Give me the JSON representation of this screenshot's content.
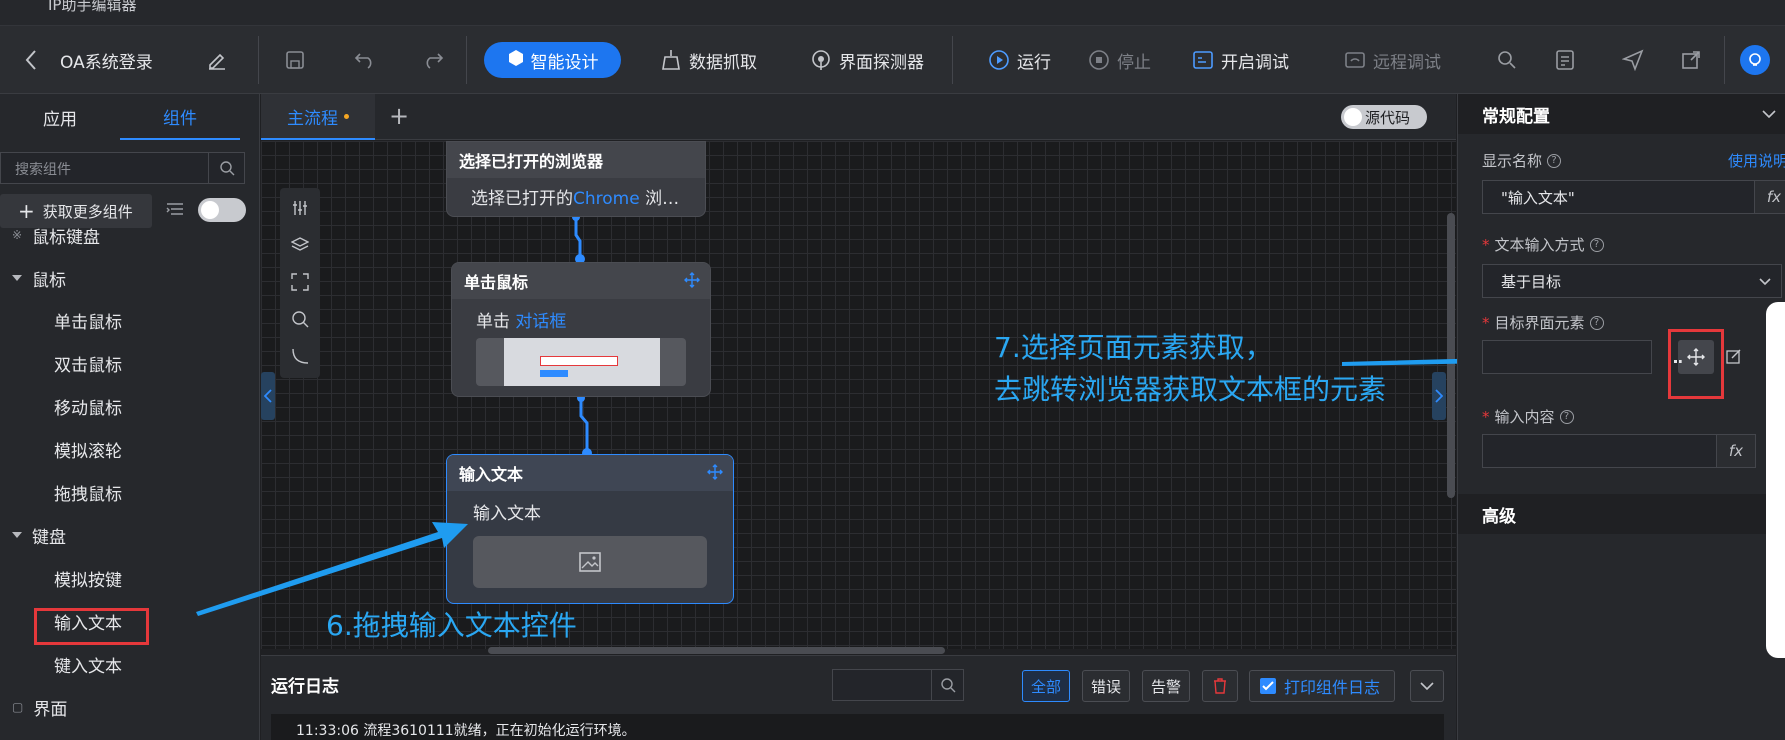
{
  "window": {
    "title": "IP助手编辑器"
  },
  "toolbar": {
    "project_name": "OA系统登录",
    "smart_design": "智能设计",
    "data_capture": "数据抓取",
    "ui_detector": "界面探测器",
    "run": "运行",
    "stop": "停止",
    "debug": "开启调试",
    "remote_debug": "远程调试"
  },
  "left": {
    "tabs": [
      "应用",
      "组件"
    ],
    "active_tab": "组件",
    "search_placeholder": "搜索组件",
    "more_components": "获取更多组件",
    "tree": {
      "partial_group": "鼠标键盘",
      "mouse_group": "鼠标",
      "mouse_items": [
        "单击鼠标",
        "双击鼠标",
        "移动鼠标",
        "模拟滚轮",
        "拖拽鼠标"
      ],
      "keyboard_group": "键盘",
      "keyboard_items": [
        "模拟按键",
        "输入文本",
        "键入文本"
      ],
      "ui_group": "界面"
    }
  },
  "canvas": {
    "tab": "主流程",
    "source_code": "源代码",
    "nodes": [
      {
        "title": "选择已打开的浏览器",
        "body_prefix": "选择已打开的",
        "body_link": "Chrome",
        "body_suffix": " 浏…"
      },
      {
        "title": "单击鼠标",
        "body_prefix": "单击 ",
        "body_link": "对话框"
      },
      {
        "title": "输入文本",
        "body_prefix": "输入文本"
      }
    ],
    "annotation_6": "6.拖拽输入文本控件",
    "annotation_7_line1": "7.选择页面元素获取，",
    "annotation_7_line2": "去跳转浏览器获取文本框的元素"
  },
  "runlog": {
    "title": "运行日志",
    "filters": [
      "全部",
      "错误",
      "告警"
    ],
    "active_filter": "全部",
    "print_log": "打印组件日志",
    "line": "11:33:06 流程3610111就绪，正在初始化运行环境。"
  },
  "right": {
    "section_general": "常规配置",
    "display_name_label": "显示名称",
    "usage_link": "使用说明",
    "display_name_value": "\"输入文本\"",
    "input_mode_label": "文本输入方式",
    "input_mode_value": "基于目标",
    "target_label": "目标界面元素",
    "content_label": "输入内容",
    "fx": "fx",
    "section_advanced": "高级"
  },
  "colors": {
    "accent": "#2e8bff",
    "highlight_red": "#e5383b",
    "annotation": "#2aa7f2"
  }
}
